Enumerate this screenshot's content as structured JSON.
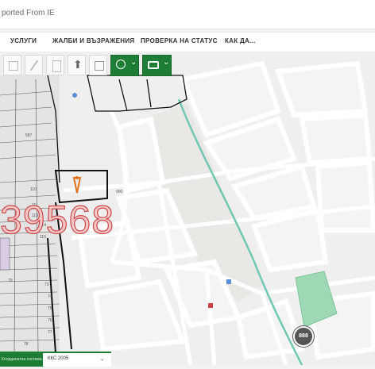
{
  "favorites_bar": {
    "text": "ported From IE"
  },
  "nav": {
    "items": [
      {
        "label": "УСЛУГИ"
      },
      {
        "label": "ЖАЛБИ И ВЪЗРАЖЕНИЯ"
      },
      {
        "label": "ПРОВЕРКА НА СТАТУС"
      },
      {
        "label": "КАК ДА..."
      }
    ]
  },
  "toolbar": {
    "green_caret_1": "⌄",
    "green_caret_2": "⌄"
  },
  "map": {
    "big_label": "39568",
    "badge_label": "888",
    "parcel_labels": [
      "587",
      "110",
      "111",
      "113",
      "114",
      "115",
      "73",
      "74",
      "75",
      "76",
      "77",
      "78",
      "79"
    ],
    "road_label": "900"
  },
  "status": {
    "label": "Координатна система",
    "value": "ККС 2005",
    "caret": "⌄"
  },
  "colors": {
    "green": "#1e7d34",
    "canal": "#6fc7b4",
    "field": "#9fd8b5",
    "parcel": "#111111"
  }
}
